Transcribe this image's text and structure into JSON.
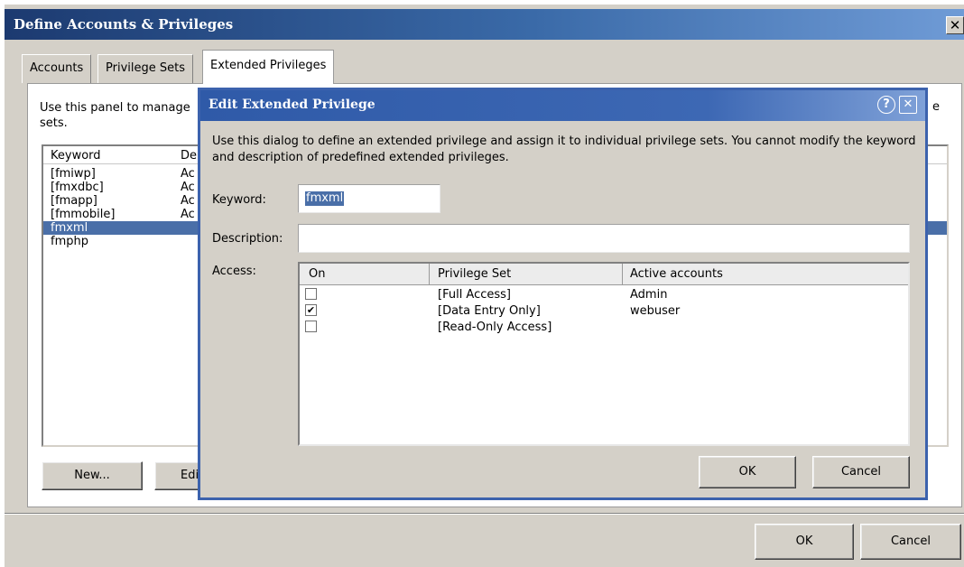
{
  "window": {
    "title": "Define Accounts & Privileges",
    "close_glyph": "✕",
    "tabs": [
      {
        "label": "Accounts"
      },
      {
        "label": "Privilege Sets"
      },
      {
        "label": "Extended Privileges"
      }
    ],
    "description_visible": "Use this panel to manage",
    "description_line2": "sets.",
    "description_right": "e",
    "list": {
      "headers": {
        "keyword": "Keyword",
        "description": "De"
      },
      "rows": [
        {
          "keyword": "[fmiwp]",
          "description": "Ac"
        },
        {
          "keyword": "[fmxdbc]",
          "description": "Ac"
        },
        {
          "keyword": "[fmapp]",
          "description": "Ac"
        },
        {
          "keyword": "[fmmobile]",
          "description": "Ac"
        },
        {
          "keyword": "fmxml",
          "description": ""
        },
        {
          "keyword": "fmphp",
          "description": ""
        }
      ],
      "selected_index": 4
    },
    "new_button": "New...",
    "edit_button": "Edi",
    "ok_button": "OK",
    "cancel_button": "Cancel"
  },
  "dialog": {
    "title": "Edit Extended Privilege",
    "help_glyph": "?",
    "close_glyph": "✕",
    "description": "Use this dialog to define an extended privilege and assign it to individual privilege sets. You cannot modify the keyword and description of predefined extended privileges.",
    "keyword_label": "Keyword:",
    "keyword_value": "fmxml",
    "description_label": "Description:",
    "description_value": "",
    "access_label": "Access:",
    "access_table": {
      "headers": {
        "on": "On",
        "privilege_set": "Privilege Set",
        "active_accounts": "Active accounts"
      },
      "rows": [
        {
          "on": false,
          "check_glyph": "",
          "privilege_set": "[Full Access]",
          "active_accounts": "Admin"
        },
        {
          "on": true,
          "check_glyph": "✔",
          "privilege_set": "[Data Entry Only]",
          "active_accounts": "webuser"
        },
        {
          "on": false,
          "check_glyph": "",
          "privilege_set": "[Read-Only Access]",
          "active_accounts": ""
        }
      ]
    },
    "ok_button": "OK",
    "cancel_button": "Cancel"
  }
}
